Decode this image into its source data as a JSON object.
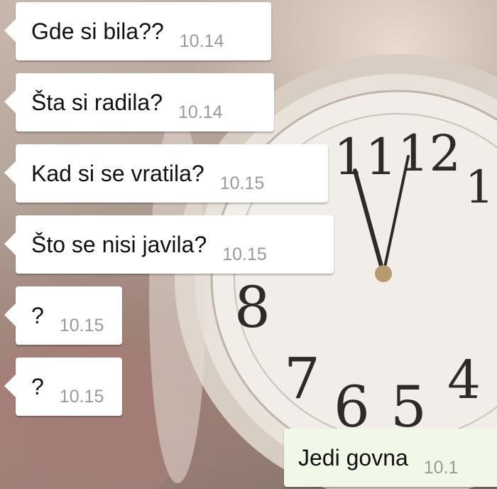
{
  "messages": [
    {
      "direction": "in",
      "text": "Gde si bila??",
      "time": "10.14"
    },
    {
      "direction": "in",
      "text": "Šta si radila?",
      "time": "10.14"
    },
    {
      "direction": "in",
      "text": "Kad si se vratila?",
      "time": "10.15"
    },
    {
      "direction": "in",
      "text": "Što se nisi javila?",
      "time": "10.15"
    },
    {
      "direction": "in",
      "text": "?",
      "time": "10.15"
    },
    {
      "direction": "in",
      "text": "?",
      "time": "10.15"
    },
    {
      "direction": "out",
      "text": "Jedi govna",
      "time": "10.1"
    }
  ],
  "background": {
    "clock_numerals": [
      "11",
      "12",
      "1",
      "8",
      "7",
      "6",
      "5",
      "4"
    ],
    "colors": {
      "bubble_in": "#ffffff",
      "bubble_out": "#f2f8e8",
      "timestamp": "#9a9a9a"
    }
  }
}
